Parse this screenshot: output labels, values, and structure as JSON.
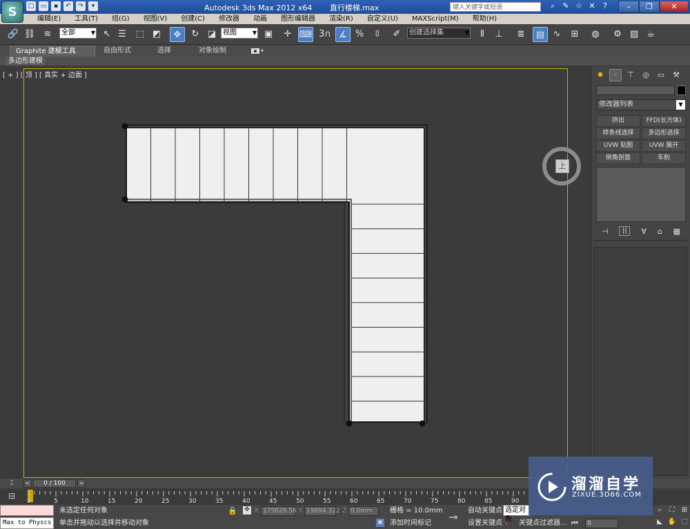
{
  "app": {
    "logo_text": "S",
    "title": "Autodesk 3ds Max  2012 x64",
    "file": "直行楼梯.max",
    "search_placeholder": "键入关键字或短语"
  },
  "menu": [
    "编辑(E)",
    "工具(T)",
    "组(G)",
    "视图(V)",
    "创建(C)",
    "修改器",
    "动画",
    "图形编辑器",
    "渲染(R)",
    "自定义(U)",
    "MAXScript(M)",
    "帮助(H)"
  ],
  "toolbar": {
    "selection_filter": "全部",
    "ref_coord": "视图",
    "snap_value": "3",
    "named_selection": "创建选择集"
  },
  "ribbon": {
    "tabs": [
      "Graphite 建模工具",
      "自由形式",
      "选择",
      "对象绘制"
    ],
    "sub_tab": "多边形建模"
  },
  "viewport": {
    "label": "[ + ] [ 顶 ] [ 真实 + 边面 ]",
    "viewcube_face": "上"
  },
  "command_panel": {
    "modifier_list": "修改器列表",
    "modifier_buttons": [
      "挤出",
      "FFD(长方体)",
      "样条线选择",
      "多边形选择",
      "UVW 贴图",
      "UVW 展开",
      "倒角剖面",
      "车削"
    ]
  },
  "timeline": {
    "frame": "0 / 100",
    "ticks": [
      "0",
      "5",
      "10",
      "15",
      "20",
      "25",
      "30",
      "35",
      "40",
      "45",
      "50",
      "55",
      "60",
      "65",
      "70",
      "75",
      "80",
      "85",
      "90"
    ]
  },
  "status": {
    "script_label": "Max to Physcs (",
    "selection": "未选定任何对象",
    "prompt": "单击并拖动以选择并移动对象",
    "x_label": "X:",
    "x": "175629.56",
    "y_label": "Y:",
    "y": "19894.322",
    "z_label": "Z:",
    "z": "0.0mm",
    "grid": "栅格 = 10.0mm",
    "add_time_tag": "添加时间标记",
    "auto_key": "自动关键点",
    "set_key": "设置关键点",
    "selected": "选定对象",
    "key_filters": "关键点过滤器...",
    "current_frame": "0"
  },
  "watermark": {
    "brand": "溜溜自学",
    "url": "ZIXUE.3D66.COM"
  }
}
